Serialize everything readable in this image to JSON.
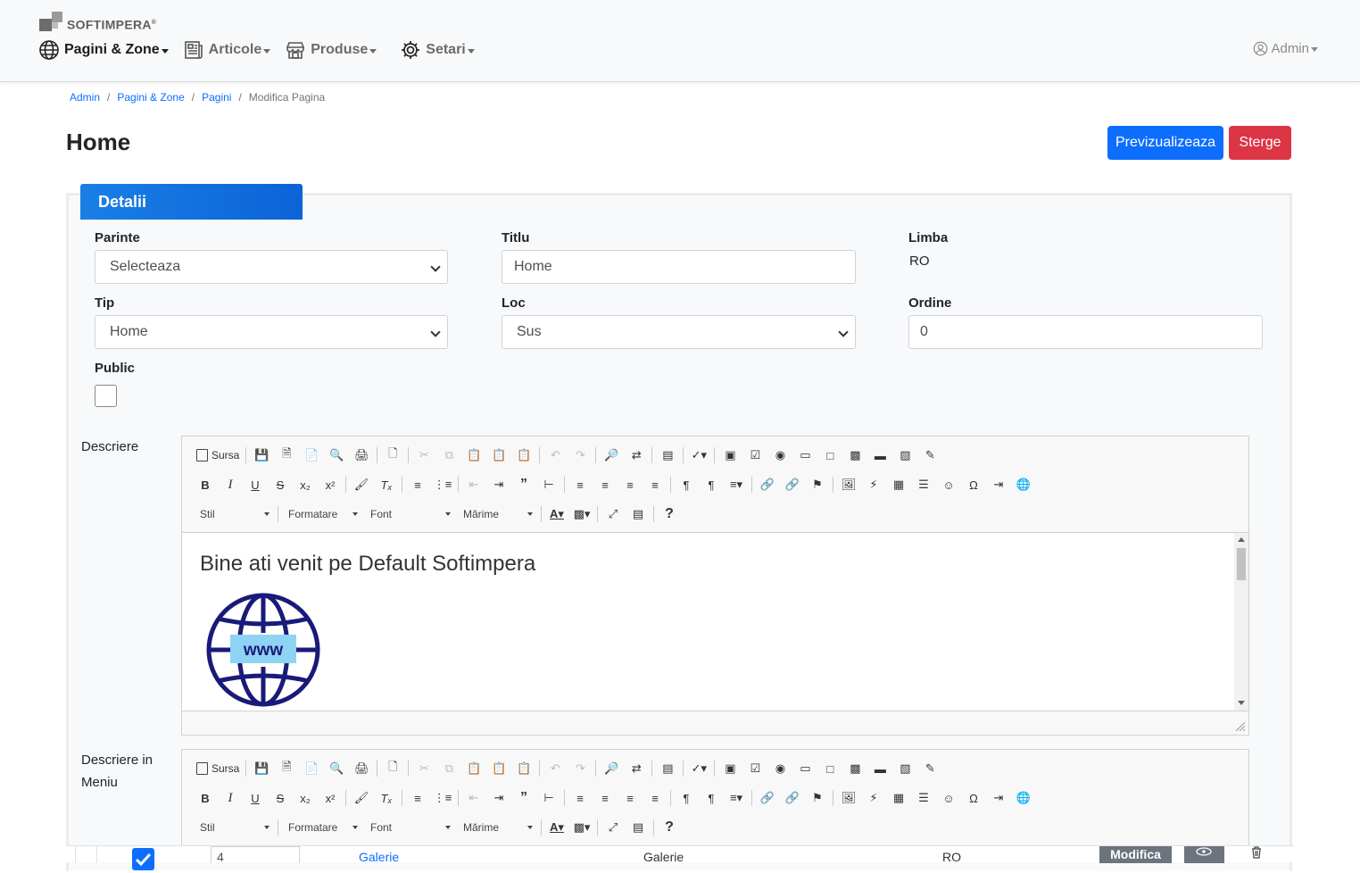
{
  "brand": {
    "name": "SOFTIMPERA",
    "mark": "®"
  },
  "nav": {
    "items": [
      {
        "label": "Pagini & Zone",
        "icon": "globe-icon",
        "active": true
      },
      {
        "label": "Articole",
        "icon": "newspaper-icon",
        "active": false
      },
      {
        "label": "Produse",
        "icon": "store-icon",
        "active": false
      },
      {
        "label": "Setari",
        "icon": "gear-icon",
        "active": false
      }
    ],
    "user": "Admin"
  },
  "breadcrumb": [
    "Admin",
    "Pagini & Zone",
    "Pagini",
    "Modifica Pagina"
  ],
  "page": {
    "title": "Home",
    "preview_label": "Previzualizeaza",
    "delete_label": "Sterge"
  },
  "card": {
    "tab": "Detalii"
  },
  "form": {
    "parinte": {
      "label": "Parinte",
      "value": "Selecteaza"
    },
    "titlu": {
      "label": "Titlu",
      "value": "Home"
    },
    "limba": {
      "label": "Limba",
      "value": "RO"
    },
    "tip": {
      "label": "Tip",
      "value": "Home"
    },
    "loc": {
      "label": "Loc",
      "value": "Sus"
    },
    "ordine": {
      "label": "Ordine",
      "value": "0"
    },
    "public": {
      "label": "Public",
      "checked": false
    },
    "descriere": {
      "label": "Descriere"
    },
    "descriere_meniu": {
      "label_line1": "Descriere in",
      "label_line2": "Meniu"
    }
  },
  "editor": {
    "source_label": "Sursa",
    "combos": {
      "style": "Stil",
      "format": "Formatare",
      "font": "Font",
      "size": "Mărime"
    },
    "content_heading": "Bine ati venit pe Default Softimpera",
    "image_text": "www"
  },
  "table_row": {
    "order": "4",
    "name_link": "Galerie",
    "name": "Galerie",
    "lang": "RO",
    "edit_label": "Modifica"
  },
  "colors": {
    "primary": "#0d6efd",
    "danger": "#dc3545",
    "tab": "#0b63d8",
    "globe": "#1a1a7a",
    "www_bg": "#8fd3f4"
  }
}
